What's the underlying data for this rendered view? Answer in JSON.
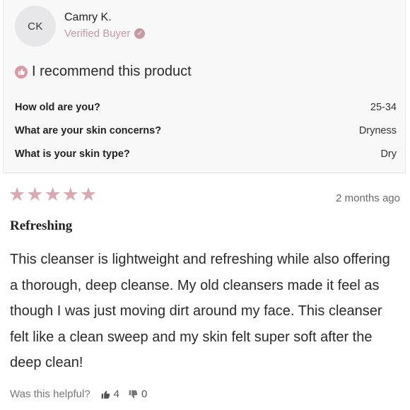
{
  "reviewer": {
    "initials": "CK",
    "name": "Camry K.",
    "badge": "Verified Buyer"
  },
  "recommend": {
    "text": "I recommend this product"
  },
  "questions": [
    {
      "question": "How old are you?",
      "answer": "25-34"
    },
    {
      "question": "What are your skin concerns?",
      "answer": "Dryness"
    },
    {
      "question": "What is your skin type?",
      "answer": "Dry"
    }
  ],
  "review": {
    "rating": 5,
    "rating_max": 5,
    "date": "2 months ago",
    "title": "Refreshing",
    "body": "This cleanser is lightweight and refreshing while also offering a thorough, deep cleanse. My old cleansers made it feel as though I was just moving dirt around my face. This cleanser felt like a clean sweep and my skin felt super soft after the deep clean!"
  },
  "helpful": {
    "label": "Was this helpful?",
    "yes_count": "4",
    "no_count": "0",
    "yes_icon": "thumbs-up-icon",
    "no_icon": "thumbs-down-icon"
  },
  "colors": {
    "accent": "#c59aa1",
    "star": "#d8a9b1",
    "card_bg": "#f8f8f9"
  }
}
